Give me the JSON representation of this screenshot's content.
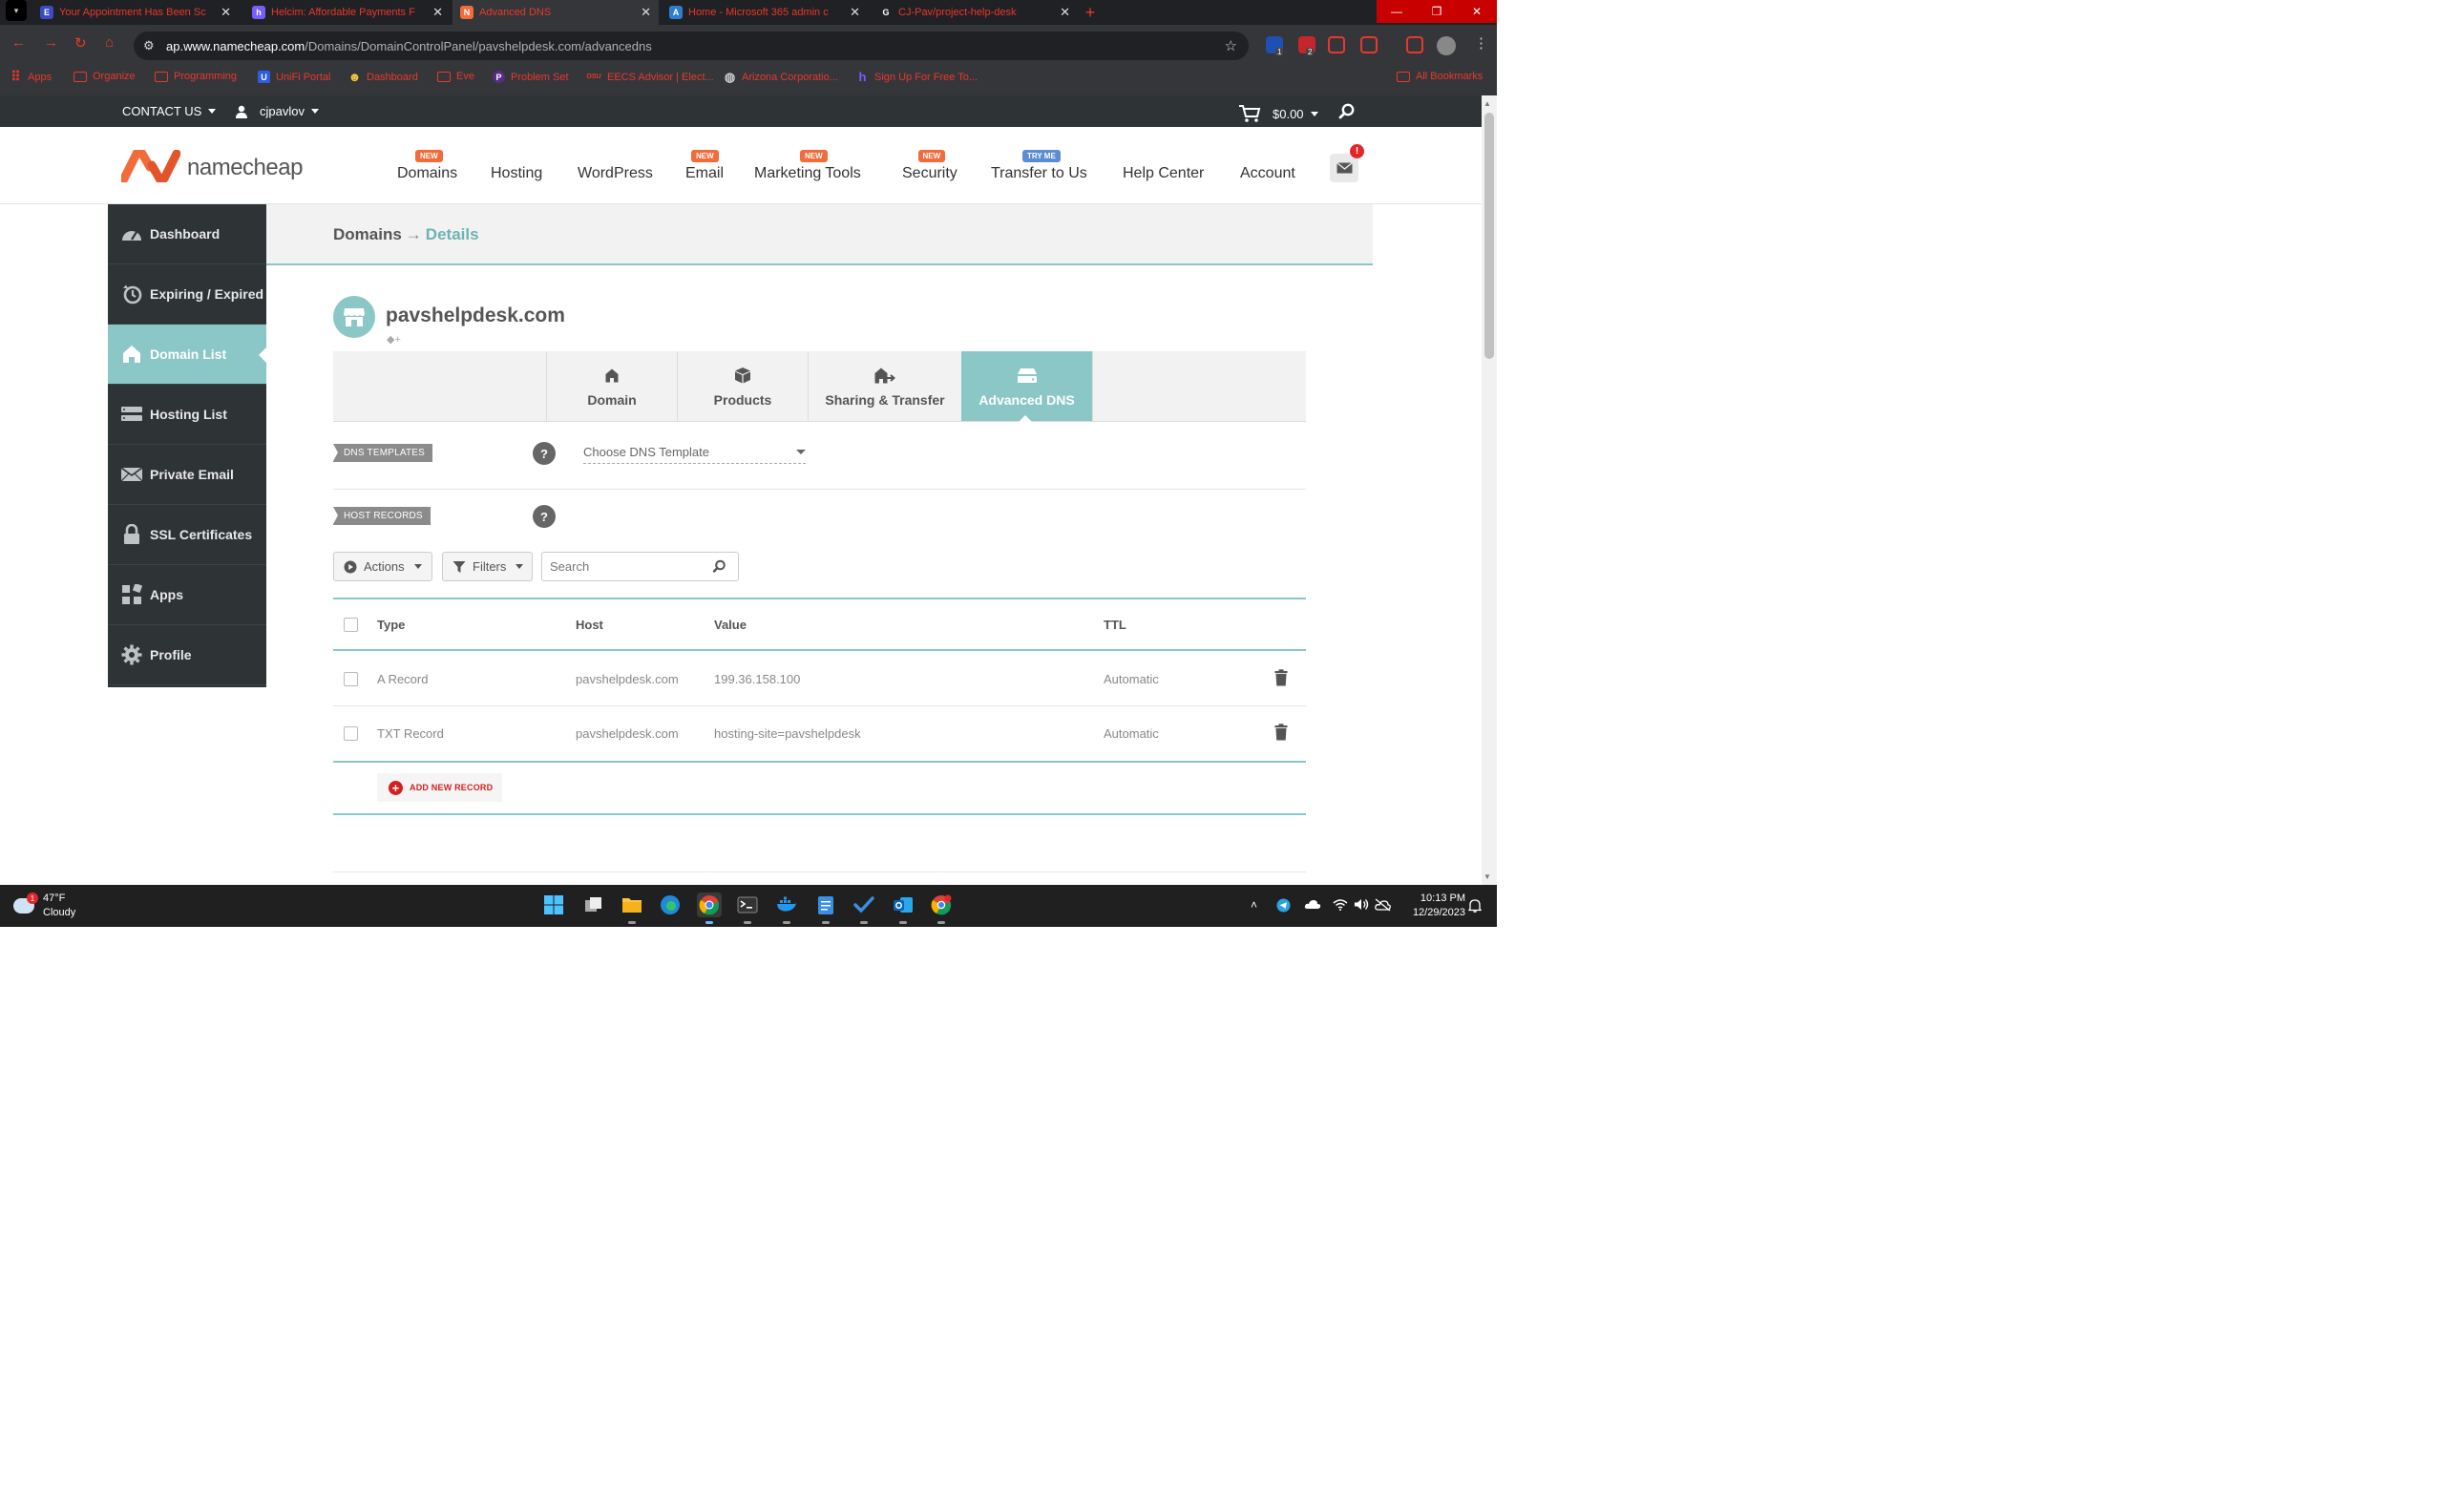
{
  "browser": {
    "tabs": [
      {
        "title": "Your Appointment Has Been Sc",
        "icon": "E",
        "icon_color": "#3b4cc0"
      },
      {
        "title": "Helcim: Affordable Payments F",
        "icon": "h",
        "icon_color": "#7b5cff"
      },
      {
        "title": "Advanced DNS",
        "icon": "N",
        "icon_color": "#f26b3a"
      },
      {
        "title": "Home - Microsoft 365 admin c",
        "icon": "A",
        "icon_color": "#2f7dd1"
      },
      {
        "title": "CJ-Pav/project-help-desk",
        "icon": "G",
        "icon_color": "#ffffff"
      }
    ],
    "active_tab_index": 2,
    "url_host": "ap.www.namecheap.com",
    "url_path": "/Domains/DomainControlPanel/pavshelpdesk.com/advancedns",
    "bookmarks": [
      {
        "label": "Apps",
        "icon": "grid-icon"
      },
      {
        "label": "Organize",
        "icon": "folder-icon"
      },
      {
        "label": "Programming",
        "icon": "folder-icon"
      },
      {
        "label": "UniFi Portal",
        "icon": "U"
      },
      {
        "label": "Dashboard",
        "icon": "smiley-icon"
      },
      {
        "label": "Eve",
        "icon": "folder-icon"
      },
      {
        "label": "Problem Set",
        "icon": "P"
      },
      {
        "label": "EECS Advisor | Elect...",
        "icon": "OSU"
      },
      {
        "label": "Arizona Corporatio...",
        "icon": "globe-icon"
      },
      {
        "label": "Sign Up For Free To...",
        "icon": "h"
      }
    ],
    "all_bookmarks": "All Bookmarks",
    "extension_badges": [
      "1",
      "2"
    ]
  },
  "topbar": {
    "contact": "CONTACT US",
    "user": "cjpavlov",
    "cart_total": "$0.00"
  },
  "header": {
    "logo": "namecheap",
    "nav": [
      {
        "label": "Domains",
        "badge": "NEW"
      },
      {
        "label": "Hosting",
        "badge": ""
      },
      {
        "label": "WordPress",
        "badge": ""
      },
      {
        "label": "Email",
        "badge": "NEW"
      },
      {
        "label": "Marketing Tools",
        "badge": "NEW"
      },
      {
        "label": "Security",
        "badge": "NEW"
      },
      {
        "label": "Transfer to Us",
        "badge": "TRY ME"
      },
      {
        "label": "Help Center",
        "badge": ""
      },
      {
        "label": "Account",
        "badge": ""
      }
    ],
    "notification": "!"
  },
  "sidebar": {
    "items": [
      {
        "label": "Dashboard",
        "icon": "speedometer-icon"
      },
      {
        "label": "Expiring / Expired",
        "icon": "clock-icon"
      },
      {
        "label": "Domain List",
        "icon": "home-icon"
      },
      {
        "label": "Hosting List",
        "icon": "server-icon"
      },
      {
        "label": "Private Email",
        "icon": "envelope-icon"
      },
      {
        "label": "SSL Certificates",
        "icon": "lock-icon"
      },
      {
        "label": "Apps",
        "icon": "apps-icon"
      },
      {
        "label": "Profile",
        "icon": "gear-icon"
      }
    ],
    "active_index": 2
  },
  "breadcrumb": {
    "parent": "Domains",
    "arrow": "→",
    "current": "Details"
  },
  "domain": {
    "name": "pavshelpdesk.com"
  },
  "domain_tabs": [
    {
      "label": "Domain",
      "icon": "house-icon"
    },
    {
      "label": "Products",
      "icon": "box-icon"
    },
    {
      "label": "Sharing & Transfer",
      "icon": "share-house-icon"
    },
    {
      "label": "Advanced DNS",
      "icon": "dns-icon"
    }
  ],
  "active_domain_tab": 3,
  "dns_templates": {
    "title": "DNS TEMPLATES",
    "help": "?",
    "select_placeholder": "Choose DNS Template"
  },
  "host_records": {
    "title": "HOST RECORDS",
    "help": "?",
    "actions_label": "Actions",
    "filters_label": "Filters",
    "search_placeholder": "Search",
    "columns": {
      "type": "Type",
      "host": "Host",
      "value": "Value",
      "ttl": "TTL"
    },
    "rows": [
      {
        "type": "A Record",
        "host": "pavshelpdesk.com",
        "value": "199.36.158.100",
        "ttl": "Automatic"
      },
      {
        "type": "TXT Record",
        "host": "pavshelpdesk.com",
        "value": "hosting-site=pavshelpdesk",
        "ttl": "Automatic"
      }
    ],
    "add_label": "ADD NEW RECORD"
  },
  "taskbar": {
    "weather_temp": "47°F",
    "weather_desc": "Cloudy",
    "weather_badge": "1",
    "time": "10:13 PM",
    "date": "12/29/2023"
  },
  "colors": {
    "accent": "#8bc7c6",
    "brand_orange": "#f26b3a",
    "sidebar_bg": "#2e3336",
    "danger": "#d6201f"
  }
}
